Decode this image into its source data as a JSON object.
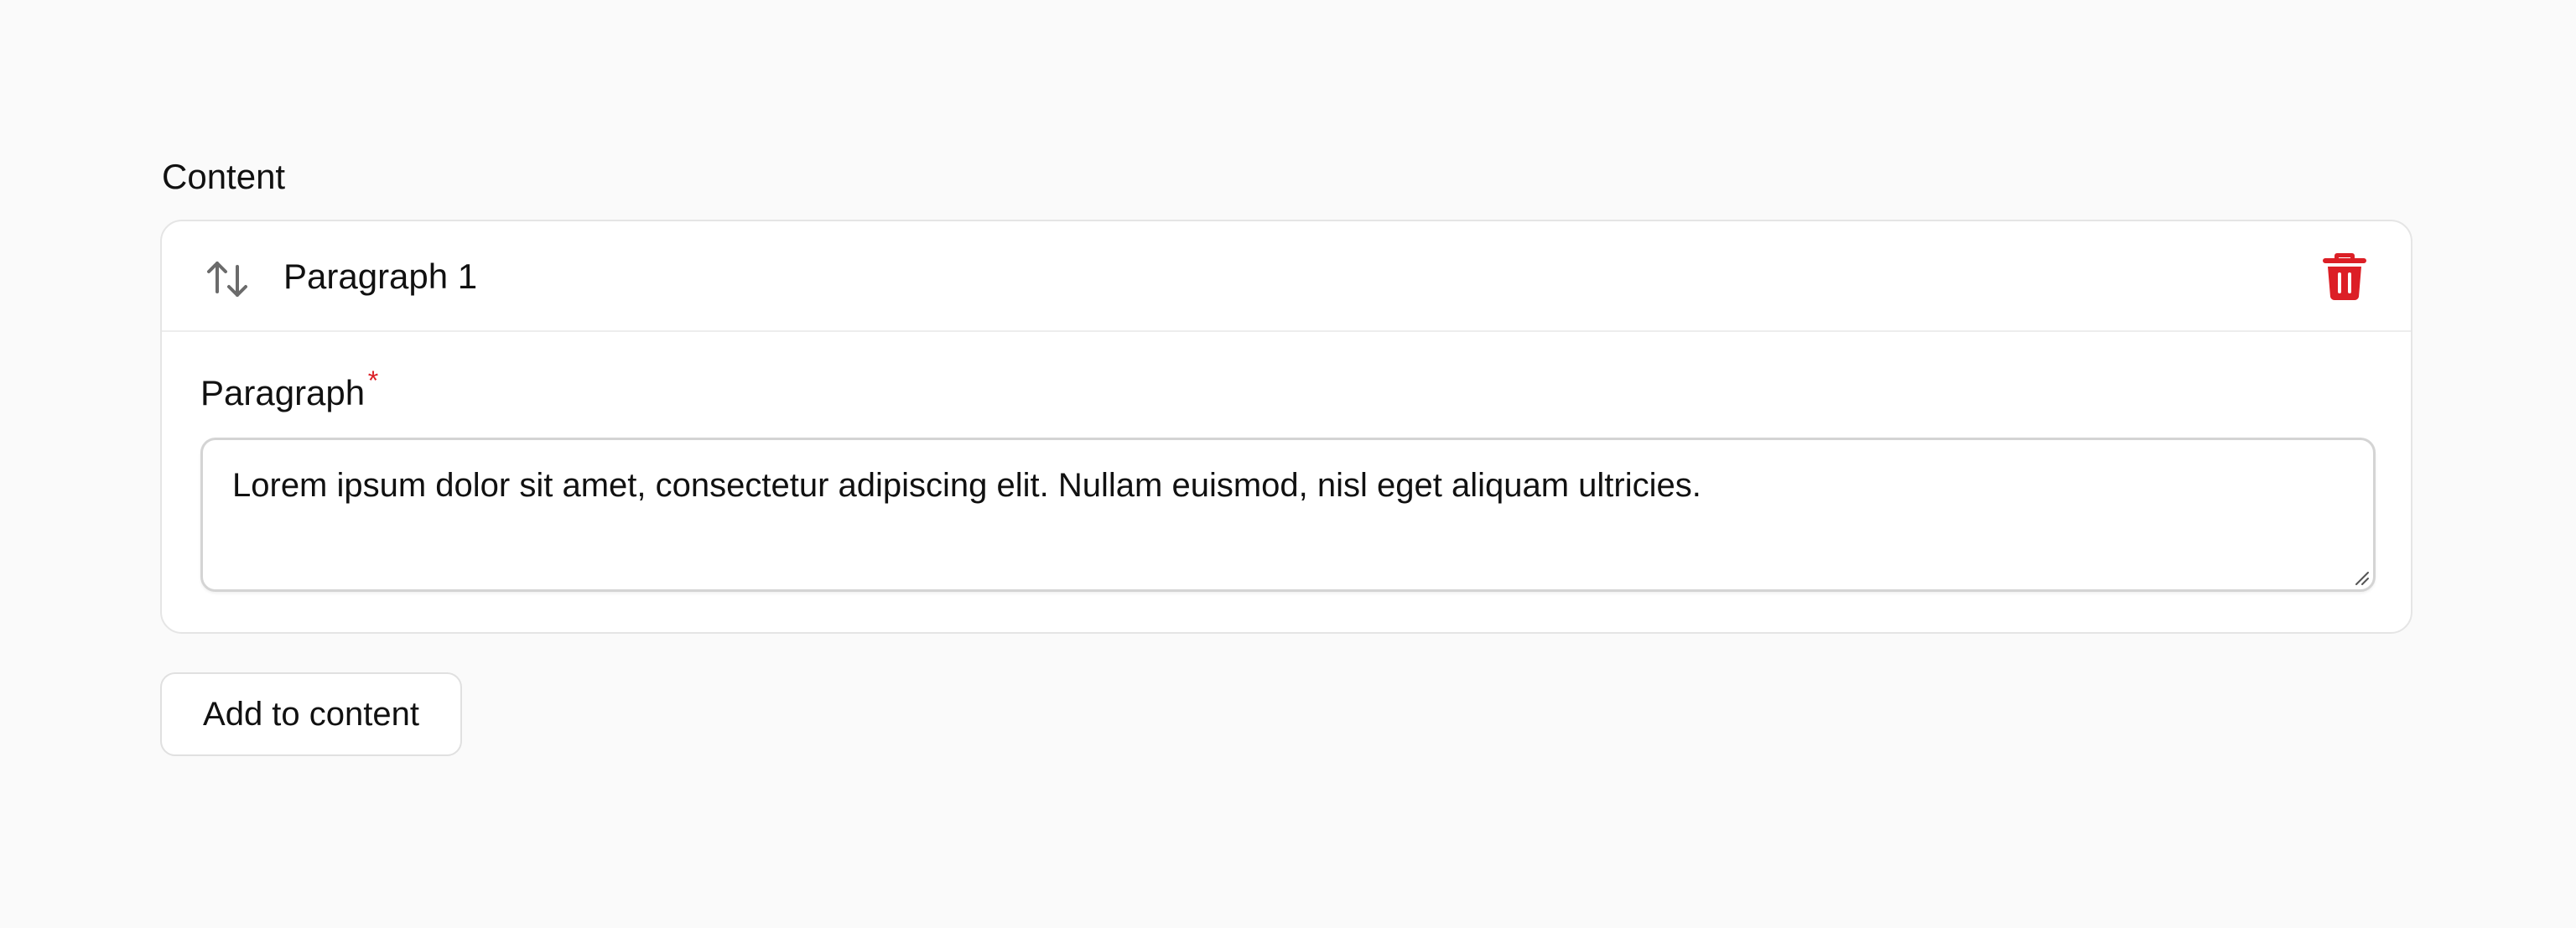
{
  "section": {
    "label": "Content"
  },
  "item": {
    "title": "Paragraph 1",
    "sort_icon": "arrows-up-down-icon",
    "delete_icon": "trash-icon",
    "delete_color": "#dc1f26"
  },
  "field": {
    "label": "Paragraph",
    "required_mark": "*",
    "value": "Lorem ipsum dolor sit amet, consectetur adipiscing elit. Nullam euismod, nisl eget aliquam ultricies."
  },
  "actions": {
    "add_label": "Add to content"
  },
  "colors": {
    "background": "#fafafa",
    "card": "#ffffff",
    "border": "#e5e5e5",
    "icon_gray": "#6b6b6b",
    "required": "#dc1f26"
  }
}
